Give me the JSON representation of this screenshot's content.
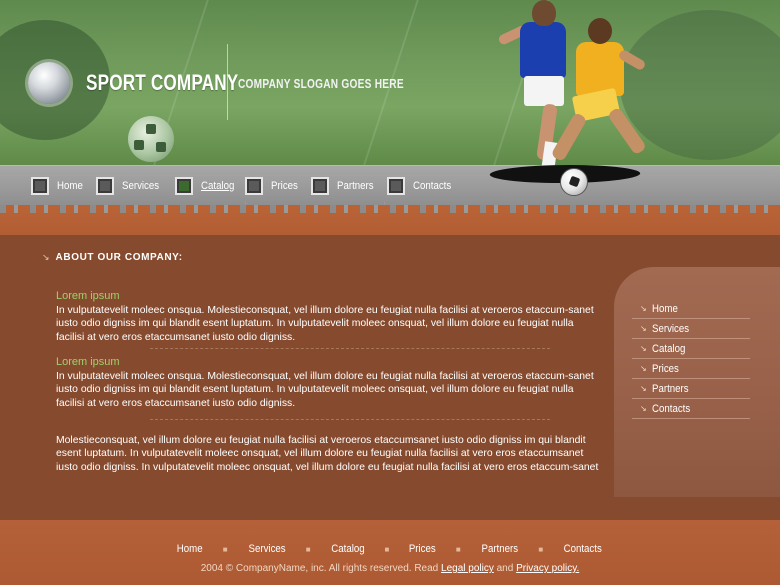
{
  "header": {
    "company_name": "SPORT COMPANY",
    "slogan": "COMPANY SLOGAN GOES HERE"
  },
  "nav": {
    "items": [
      {
        "label": "Home",
        "active": false
      },
      {
        "label": "Services",
        "active": false
      },
      {
        "label": "Catalog",
        "active": true
      },
      {
        "label": "Prices",
        "active": false
      },
      {
        "label": "Partners",
        "active": false
      },
      {
        "label": "Contacts",
        "active": false
      }
    ]
  },
  "main": {
    "heading": "ABOUT OUR COMPANY:",
    "sections": [
      {
        "title": "Lorem ipsum",
        "text": "In vulputatevelit moleec onsqua. Molestieconsquat, vel illum dolore eu feugiat nulla facilisi at veroeros etaccum-sanet iusto odio digniss im qui blandit esent luptatum. In vulputatevelit moleec onsquat, vel illum dolore eu feugiat nulla facilisi at vero eros etaccumsanet iusto odio digniss."
      },
      {
        "title": "Lorem ipsum",
        "text": "In vulputatevelit moleec onsqua. Molestieconsquat, vel illum dolore eu feugiat nulla facilisi at veroeros etaccum-sanet iusto odio digniss im qui blandit esent luptatum. In vulputatevelit moleec onsquat, vel illum dolore eu feugiat nulla facilisi at vero eros etaccumsanet iusto odio digniss."
      }
    ],
    "closing_text": "Molestieconsquat, vel illum dolore eu feugiat nulla facilisi at veroeros etaccumsanet iusto odio digniss im qui blandit esent luptatum. In vulputatevelit moleec onsquat, vel illum dolore eu feugiat nulla facilisi at vero eros etaccumsanet iusto odio digniss. In vulputatevelit moleec onsquat, vel illum dolore eu feugiat nulla facilisi at vero eros etaccum-sanet"
  },
  "sidebar": {
    "items": [
      "Home",
      "Services",
      "Catalog",
      "Prices",
      "Partners",
      "Contacts"
    ]
  },
  "footer": {
    "links": [
      "Home",
      "Services",
      "Catalog",
      "Prices",
      "Partners",
      "Contacts"
    ],
    "copyright_prefix": "2004 © CompanyName, inc. All rights reserved. Read",
    "legal_label": "Legal policy",
    "and": "and",
    "privacy_label": "Privacy policy."
  },
  "colors": {
    "accent_green": "#9fd06a",
    "main_brown": "#864b2f",
    "footer_rust": "#b15c33"
  }
}
